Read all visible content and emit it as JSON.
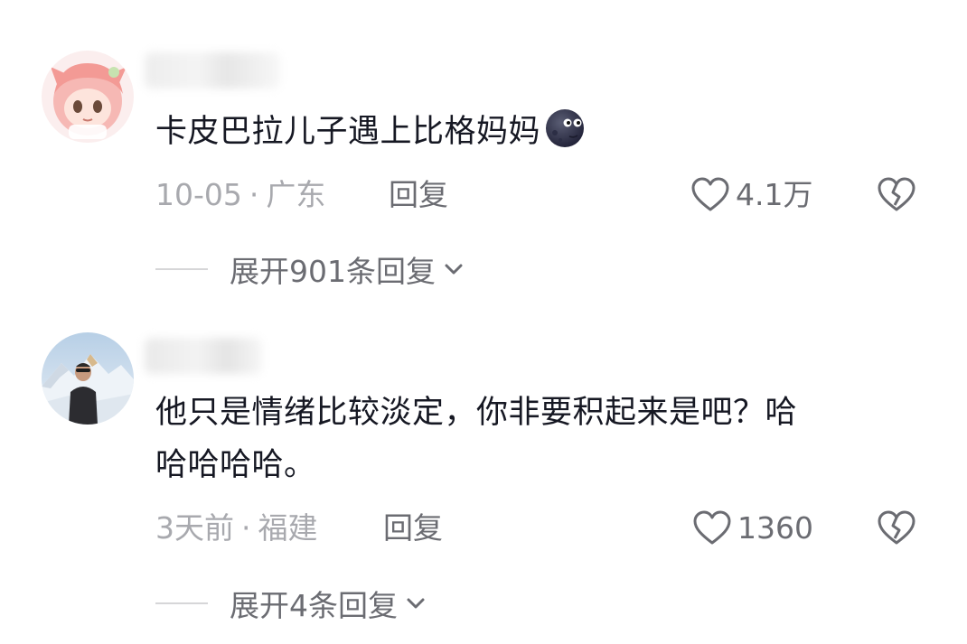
{
  "comments": [
    {
      "text": "卡皮巴拉儿子遇上比格妈妈",
      "emoji": "new-moon-face-emoji",
      "date": "10-05",
      "separator": "·",
      "location": "广东",
      "reply_label": "回复",
      "likes": "4.1万",
      "expand_label": "展开901条回复"
    },
    {
      "text_line1": "他只是情绪比较淡定，你非要积起来是吧？哈",
      "text_line2": "哈哈哈哈。",
      "date": "3天前",
      "separator": "·",
      "location": "福建",
      "reply_label": "回复",
      "likes": "1360",
      "expand_label": "展开4条回复"
    }
  ],
  "colors": {
    "primary_text": "#161823",
    "secondary_text": "#a8a9ae",
    "action_text": "#6b6c72",
    "divider": "#d6d6d8"
  }
}
